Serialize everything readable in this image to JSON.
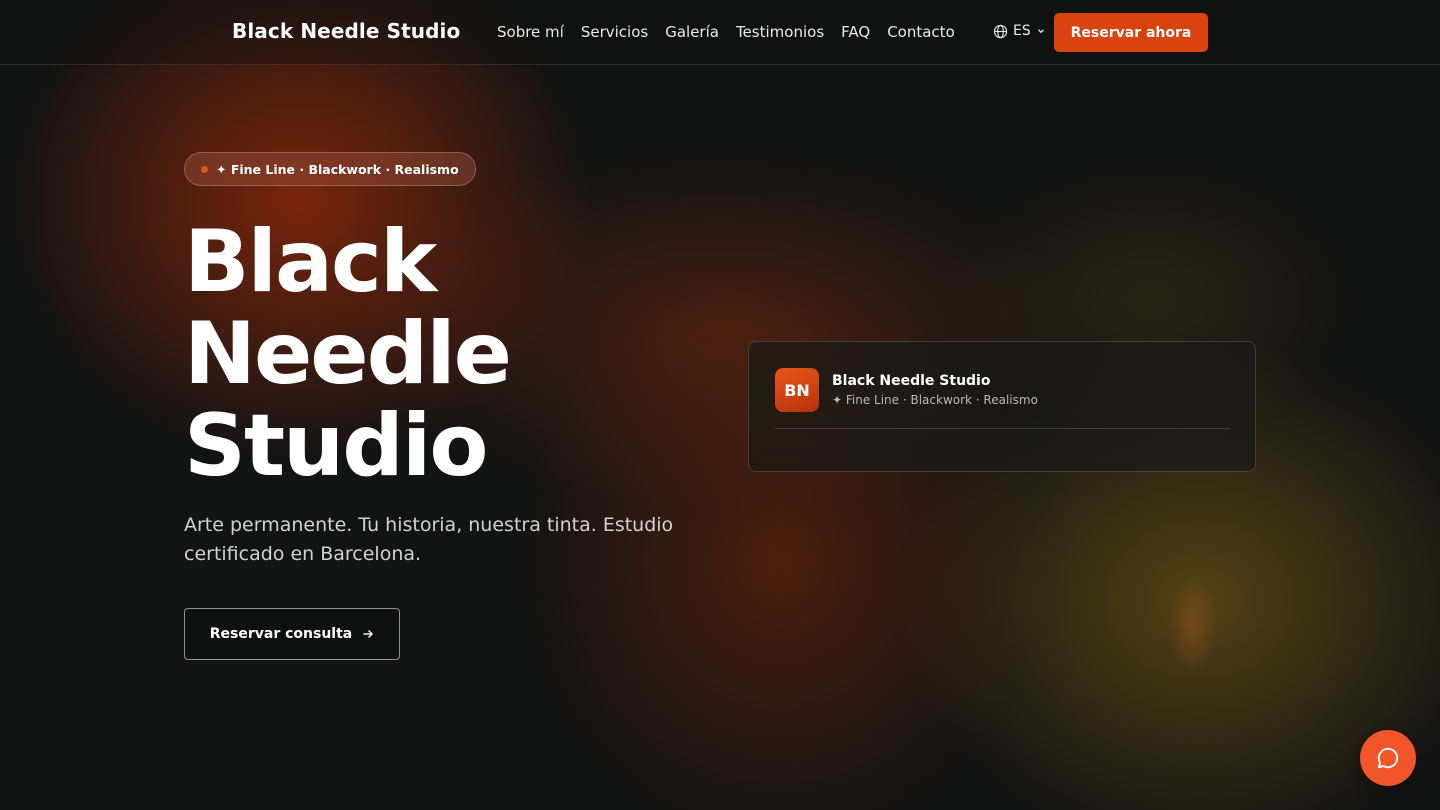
{
  "header": {
    "brand": "Black Needle Studio",
    "nav": [
      "Sobre mí",
      "Servicios",
      "Galería",
      "Testimonios",
      "FAQ",
      "Contacto"
    ],
    "language": "ES",
    "book_label": "Reservar ahora"
  },
  "hero": {
    "tag": "✦ Fine Line · Blackwork · Realismo",
    "title_lines": [
      "Black",
      "Needle",
      "Studio"
    ],
    "subtitle": "Arte permanente. Tu historia, nuestra tinta. Estudio certificado en Barcelona.",
    "cta_label": "Reservar consulta"
  },
  "card": {
    "initials": "BN",
    "title": "Black Needle Studio",
    "subtitle": "✦ Fine Line · Blackwork · Realismo"
  },
  "colors": {
    "accent": "#d9430e",
    "chat": "#f2552a",
    "background": "#121313"
  },
  "icons": {
    "language": "globe-icon",
    "dropdown": "chevron-down-icon",
    "cta": "arrow-right-icon",
    "chat": "chat-bubble-icon"
  }
}
